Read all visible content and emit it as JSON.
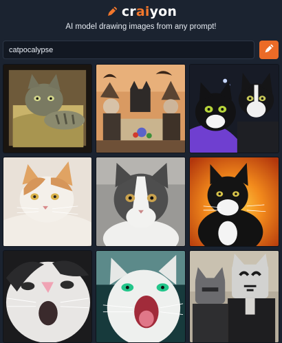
{
  "brand": {
    "logo_icon": "crayon-pencil-icon",
    "name_pre": "cr",
    "name_mid": "ai",
    "name_post": "yon",
    "accent": "#f2772c"
  },
  "header": {
    "tagline": "AI model drawing images from any prompt!"
  },
  "search": {
    "value": "catpocalypse",
    "button_icon": "crayon-pencil-icon",
    "button_color": "#ec6b27"
  },
  "results": {
    "count_rows": 3,
    "count_cols": 3,
    "images": [
      {
        "subject": "gray tabby cat lying in bed"
      },
      {
        "subject": "illustrated crowd with cats and bats"
      },
      {
        "subject": "two black and white cats in night sky"
      },
      {
        "subject": "orange and white cat portrait"
      },
      {
        "subject": "gray and white cat close-up"
      },
      {
        "subject": "black and white cat on fiery background"
      },
      {
        "subject": "white cat with pink nose shouting"
      },
      {
        "subject": "white cat with green eyes screaming"
      },
      {
        "subject": "two armored robot cats"
      }
    ]
  }
}
